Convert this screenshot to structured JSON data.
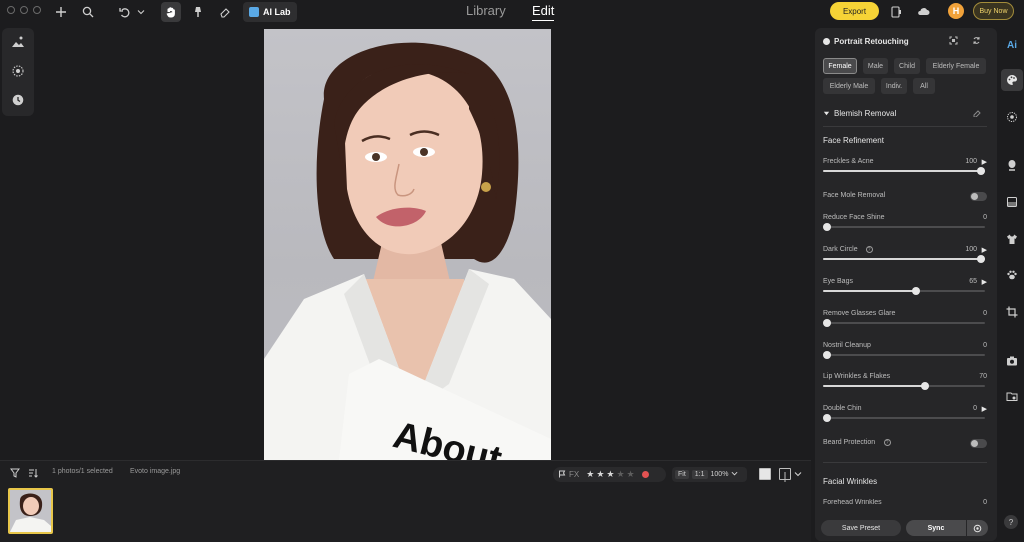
{
  "topbar": {
    "library_tab": "Library",
    "edit_tab": "Edit",
    "ai_lab_label": "AI Lab",
    "export_label": "Export",
    "avatar_initial": "H",
    "buy_now_label": "Buy Now"
  },
  "filmstrip": {
    "selection_count": "1 photos/1 selected",
    "filename": "Evoto image.jpg",
    "fx_label": "FX",
    "rating": 3,
    "fit_label": "Fit",
    "ratio_label": "1:1",
    "zoom_label": "100%"
  },
  "panel": {
    "title": "Portrait Retouching",
    "chips": [
      "Female",
      "Male",
      "Child",
      "Elderly Female",
      "Elderly Male",
      "Indiv.",
      "All"
    ],
    "selected_chip": "Female",
    "section_title": "Blemish Removal",
    "subsection_title": "Face Refinement",
    "params": [
      {
        "label": "Freckles & Acne",
        "value": "100",
        "arrow": true,
        "type": "slider",
        "level": 1.0
      },
      {
        "label": "Face Mole Removal",
        "type": "toggle",
        "on": false
      },
      {
        "label": "Reduce Face Shine",
        "value": "0",
        "type": "slider",
        "level": 0.0
      },
      {
        "label": "Dark Circle",
        "value": "100",
        "arrow": true,
        "info": true,
        "type": "slider",
        "level": 1.0
      },
      {
        "label": "Eye Bags",
        "value": "65",
        "arrow": true,
        "type": "slider",
        "level": 0.575
      },
      {
        "label": "Remove Glasses Glare",
        "value": "0",
        "type": "slider",
        "level": 0.0
      },
      {
        "label": "Nostril Cleanup",
        "value": "0",
        "type": "slider",
        "level": 0.0
      },
      {
        "label": "Lip Wrinkles & Flakes",
        "value": "70",
        "type": "slider",
        "level": 0.63
      },
      {
        "label": "Double Chin",
        "value": "0",
        "arrow": true,
        "type": "slider",
        "level": 0.0
      },
      {
        "label": "Beard Protection",
        "info": true,
        "type": "toggle",
        "on": false
      }
    ],
    "section2_title": "Facial Wrinkles",
    "partial_item": "Forehead Wrinkles",
    "partial_value": "0",
    "save_preset_label": "Save Preset",
    "sync_label": "Sync"
  },
  "sidebar_right": {
    "ai_label": "Ai",
    "help_label": "?"
  },
  "photo_text": "About",
  "colors": {
    "accent_yellow": "#f6d336",
    "avatar_orange": "#f1a23a",
    "panel_bg": "#262628",
    "app_bg": "#1c1c1e"
  }
}
